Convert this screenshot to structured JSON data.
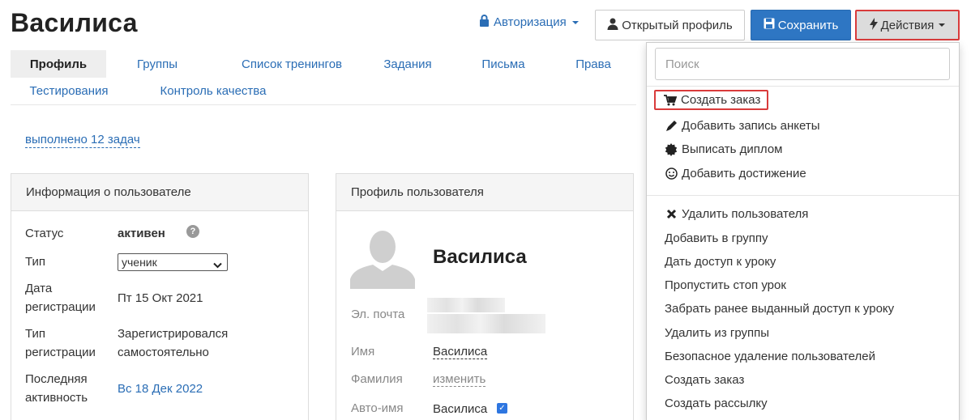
{
  "page": {
    "title": "Василиса"
  },
  "header": {
    "auth_label": "Авторизация",
    "open_profile_label": "Открытый профиль",
    "save_label": "Сохранить",
    "actions_label": "Действия"
  },
  "tabs": [
    {
      "label": "Профиль",
      "active": true
    },
    {
      "label": "Группы"
    },
    {
      "label": "Список тренингов"
    },
    {
      "label": "Задания"
    },
    {
      "label": "Письма"
    },
    {
      "label": "Права"
    },
    {
      "label": "Тестирования"
    },
    {
      "label": "Контроль качества"
    }
  ],
  "tasks_link": "выполнено 12 задач",
  "user_info": {
    "title": "Информация о пользователе",
    "status_label": "Статус",
    "status_value": "активен",
    "type_label": "Тип",
    "type_value": "ученик",
    "reg_date_label_1": "Дата",
    "reg_date_label_2": "регистрации",
    "reg_date_value": "Пт 15 Окт 2021",
    "reg_type_label_1": "Тип",
    "reg_type_label_2": "регистрации",
    "reg_type_value_1": "Зарегистрировался",
    "reg_type_value_2": "самостоятельно",
    "last_active_label_1": "Последняя",
    "last_active_label_2": "активность",
    "last_active_value": "Вс 18 Дек 2022"
  },
  "user_profile": {
    "title": "Профиль пользователя",
    "name": "Василиса",
    "email_label": "Эл. почта",
    "first_name_label": "Имя",
    "first_name_value": "Василиса",
    "last_name_label": "Фамилия",
    "last_name_value": "изменить",
    "auto_name_label": "Авто-имя",
    "auto_name_value": "Василиса",
    "auto_name_checked": true
  },
  "actions_menu": {
    "search_placeholder": "Поиск",
    "group1": [
      {
        "label": "Создать заказ",
        "icon": "cart-icon"
      },
      {
        "label": "Добавить запись анкеты",
        "icon": "pencil-icon"
      },
      {
        "label": "Выписать диплом",
        "icon": "certificate-icon"
      },
      {
        "label": "Добавить достижение",
        "icon": "smile-icon"
      }
    ],
    "group2": [
      {
        "label": "Удалить пользователя",
        "icon": "close-icon"
      },
      {
        "label": "Добавить в группу"
      },
      {
        "label": "Дать доступ к уроку"
      },
      {
        "label": "Пропустить стоп урок"
      },
      {
        "label": "Забрать ранее выданный доступ к уроку"
      },
      {
        "label": "Удалить из группы"
      },
      {
        "label": "Безопасное удаление пользователей"
      },
      {
        "label": "Создать заказ"
      },
      {
        "label": "Создать рассылку"
      }
    ]
  },
  "colors": {
    "link": "#2a6db5",
    "primary": "#2e76c3",
    "highlight": "#d93b3b"
  }
}
